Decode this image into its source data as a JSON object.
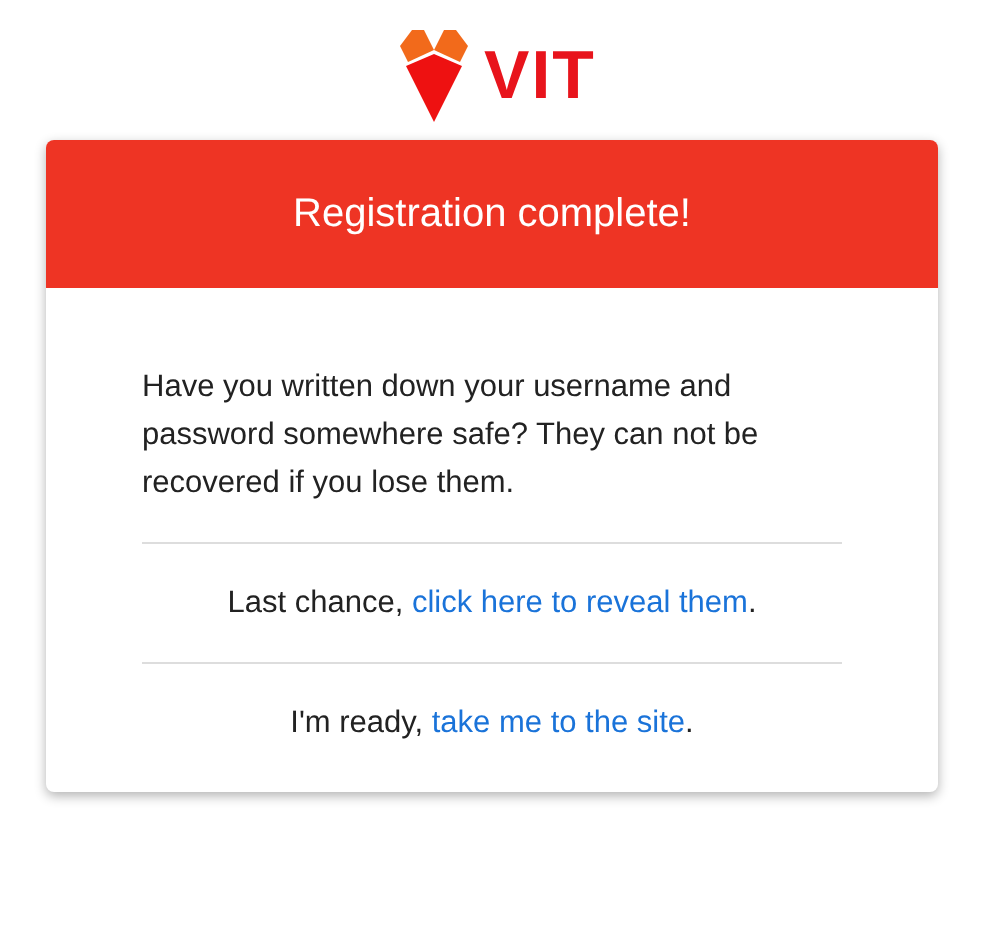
{
  "logo": {
    "text": "VIT"
  },
  "card": {
    "title": "Registration complete!",
    "message": "Have you written down your username and password somewhere safe? They can not be recovered if you lose them.",
    "lines": [
      {
        "prefix": "Last chance, ",
        "link": "click here to reveal them",
        "suffix": "."
      },
      {
        "prefix": "I'm ready, ",
        "link": "take me to the site",
        "suffix": "."
      }
    ]
  }
}
